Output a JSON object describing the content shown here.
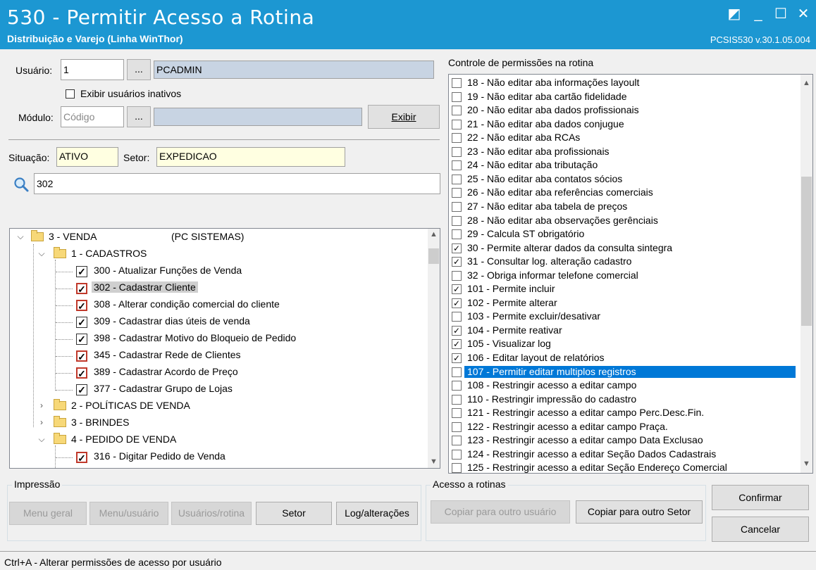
{
  "window": {
    "title": "530 - Permitir Acesso a Rotina",
    "subtitle": "Distribuição e Varejo (Linha WinThor)",
    "version": "PCSIS530  v.30.1.05.004"
  },
  "user": {
    "label": "Usuário:",
    "code": "1",
    "ellipsis": "...",
    "name": "PCADMIN",
    "show_inactive_label": "Exibir usuários inativos"
  },
  "module": {
    "label": "Módulo:",
    "code_placeholder": "Código",
    "ellipsis": "...",
    "exibir_button": "Exibir"
  },
  "situation": {
    "label": "Situação:",
    "value": "ATIVO",
    "sector_label": "Setor:",
    "sector_value": "EXPEDICAO"
  },
  "search": {
    "value": "302"
  },
  "tree": {
    "root": "3 - VENDA",
    "root_suffix": "(PC SISTEMAS)",
    "cadastros": "1 - CADASTROS",
    "items": [
      {
        "text": "300 - Atualizar Funções de Venda",
        "red": false,
        "checked": true
      },
      {
        "text": "302 - Cadastrar Cliente",
        "red": true,
        "checked": true,
        "selected": true
      },
      {
        "text": "308 - Alterar condição comercial do cliente",
        "red": true,
        "checked": true
      },
      {
        "text": "309 - Cadastrar dias úteis de venda",
        "red": false,
        "checked": true
      },
      {
        "text": "398 - Cadastrar Motivo do Bloqueio de Pedido",
        "red": false,
        "checked": true
      },
      {
        "text": "345 - Cadastrar Rede de Clientes",
        "red": true,
        "checked": true
      },
      {
        "text": "389 - Cadastrar Acordo de Preço",
        "red": true,
        "checked": true
      },
      {
        "text": "377 - Cadastrar Grupo de Lojas",
        "red": false,
        "checked": true
      }
    ],
    "politicas": "2 - POLÍTICAS DE VENDA",
    "brindes": "3 - BRINDES",
    "pedido": "4 - PEDIDO DE VENDA",
    "pedido_items": [
      {
        "text": "316 - Digitar Pedido de Venda",
        "red": true,
        "checked": true
      }
    ]
  },
  "permissions": {
    "label": "Controle de permissões na rotina",
    "items": [
      {
        "text": "18 - Não editar aba informações layoult",
        "checked": false
      },
      {
        "text": "19 - Não editar aba cartão fidelidade",
        "checked": false
      },
      {
        "text": "20 - Não editar aba dados profissionais",
        "checked": false
      },
      {
        "text": "21 - Não editar aba dados conjugue",
        "checked": false
      },
      {
        "text": "22 - Não editar aba RCAs",
        "checked": false
      },
      {
        "text": "23 - Não editar aba profissionais",
        "checked": false
      },
      {
        "text": "24 - Não editar aba tributação",
        "checked": false
      },
      {
        "text": "25 - Não editar aba contatos sócios",
        "checked": false
      },
      {
        "text": "26 - Não editar aba referências comerciais",
        "checked": false
      },
      {
        "text": "27 - Não editar aba tabela de preços",
        "checked": false
      },
      {
        "text": "28 - Não editar aba observações gerênciais",
        "checked": false
      },
      {
        "text": "29 - Calcula ST obrigatório",
        "checked": false
      },
      {
        "text": "30 - Permite alterar dados da consulta sintegra",
        "checked": true
      },
      {
        "text": "31 - Consultar log. alteração cadastro",
        "checked": true
      },
      {
        "text": "32 - Obriga informar telefone comercial",
        "checked": false
      },
      {
        "text": "101 - Permite incluir",
        "checked": true
      },
      {
        "text": "102 - Permite alterar",
        "checked": true
      },
      {
        "text": "103 - Permite excluir/desativar",
        "checked": false
      },
      {
        "text": "104 - Permite reativar",
        "checked": true
      },
      {
        "text": "105 - Visualizar log",
        "checked": true
      },
      {
        "text": "106 - Editar layout de relatórios",
        "checked": true
      },
      {
        "text": "107 - Permitir editar multiplos registros",
        "checked": false,
        "selected": true
      },
      {
        "text": "108 - Restringir acesso a editar campo",
        "checked": false
      },
      {
        "text": "110 - Restringir impressão do cadastro",
        "checked": false
      },
      {
        "text": "121 - Restringir acesso a editar campo Perc.Desc.Fin.",
        "checked": false
      },
      {
        "text": "122 - Restringir acesso a editar campo Praça.",
        "checked": false
      },
      {
        "text": "123 - Restringir acesso a editar campo Data Exclusao",
        "checked": false
      },
      {
        "text": "124 - Restringir acesso a editar Seção Dados Cadastrais",
        "checked": false
      },
      {
        "text": "125 - Restringir acesso a editar Seção Endereço Comercial",
        "checked": false
      }
    ]
  },
  "impressao": {
    "label": "Impressão",
    "menu_geral": "Menu geral",
    "menu_usuario": "Menu/usuário",
    "usuarios_rotina": "Usuários/rotina",
    "setor": "Setor",
    "log": "Log/alterações"
  },
  "acesso": {
    "label": "Acesso a rotinas",
    "copiar_usuario": "Copiar para outro usuário",
    "copiar_setor": "Copiar para outro Setor"
  },
  "actions": {
    "confirmar": "Confirmar",
    "cancelar": "Cancelar"
  },
  "status": {
    "text": "Ctrl+A - Alterar permissões de acesso por usuário"
  },
  "colors": {
    "titlebar": "#1c97d2",
    "selection": "#0078d7",
    "red_check": "#c0392b"
  }
}
